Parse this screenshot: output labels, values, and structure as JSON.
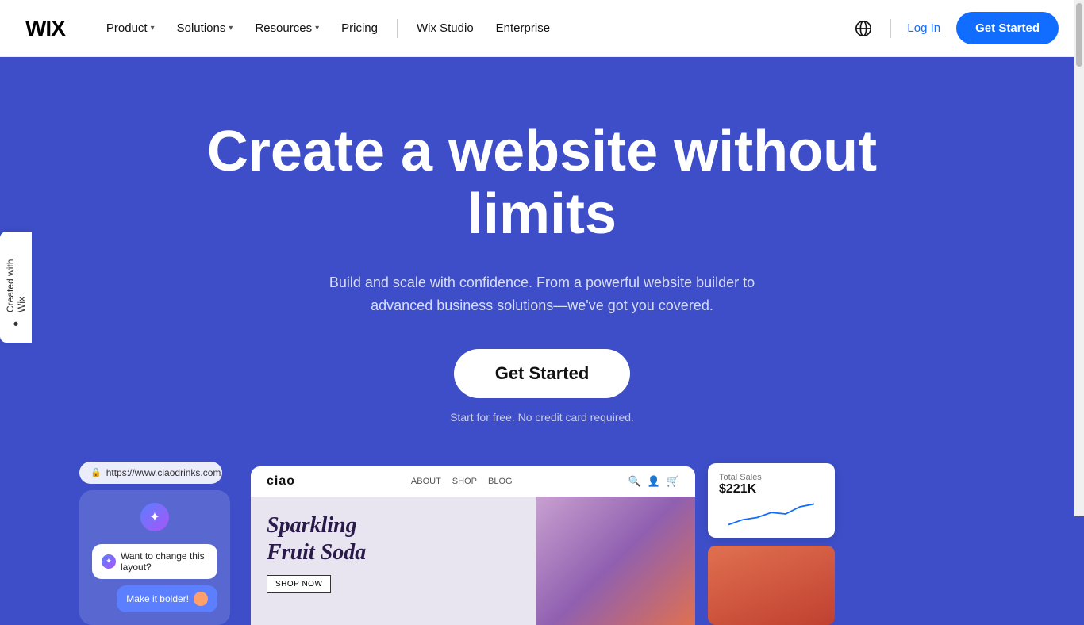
{
  "brand": {
    "logo": "WIX"
  },
  "navbar": {
    "product_label": "Product",
    "solutions_label": "Solutions",
    "resources_label": "Resources",
    "pricing_label": "Pricing",
    "wix_studio_label": "Wix Studio",
    "enterprise_label": "Enterprise",
    "login_label": "Log In",
    "cta_label": "Get Started"
  },
  "hero": {
    "title": "Create a website without limits",
    "subtitle": "Build and scale with confidence. From a powerful website builder to advanced business solutions—we've got you covered.",
    "cta_label": "Get Started",
    "free_note": "Start for free. No credit card required."
  },
  "preview_left": {
    "url": "https://www.ciaodrinks.com",
    "bubble1": "Want to change this layout?",
    "bubble2": "Make it bolder!"
  },
  "preview_center": {
    "logo": "ciao",
    "nav_about": "ABOUT",
    "nav_shop": "SHOP",
    "nav_blog": "BLOG",
    "title_line1": "Sparkling",
    "title_line2": "Fruit Soda",
    "shop_btn": "SHOP NOW"
  },
  "preview_right": {
    "stats_label": "Total Sales",
    "stats_value": "$221K"
  },
  "wix_sidebar": {
    "label": "Created with Wix"
  }
}
